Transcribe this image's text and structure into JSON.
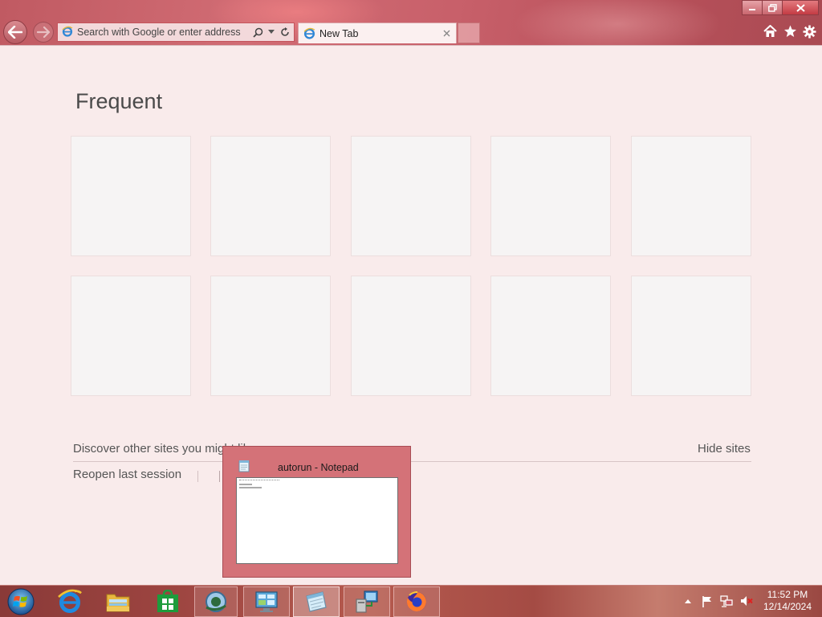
{
  "browser": {
    "address_placeholder": "Search with Google or enter address",
    "tab": {
      "label": "New Tab"
    }
  },
  "new_tab_page": {
    "title": "Frequent",
    "tile_count": 10,
    "discover_text": "Discover other sites you might lik",
    "hide_sites": "Hide sites",
    "reopen_session": "Reopen last session"
  },
  "thumbnail_preview": {
    "title": "autorun - Notepad"
  },
  "taskbar": {
    "items": [
      {
        "icon": "windows-start-icon"
      },
      {
        "icon": "internet-explorer-icon"
      },
      {
        "icon": "file-explorer-icon"
      },
      {
        "icon": "windows-store-icon"
      },
      {
        "icon": "app-icon"
      },
      {
        "icon": "control-panel-icon"
      },
      {
        "icon": "notepad-icon"
      },
      {
        "icon": "network-computer-icon"
      },
      {
        "icon": "firefox-icon"
      }
    ],
    "clock": {
      "time": "11:52 PM",
      "date": "12/14/2024"
    }
  },
  "colors": {
    "accent": "#c4545c",
    "page_background": "#f9ebeb",
    "tile": "#f6f4f4"
  }
}
